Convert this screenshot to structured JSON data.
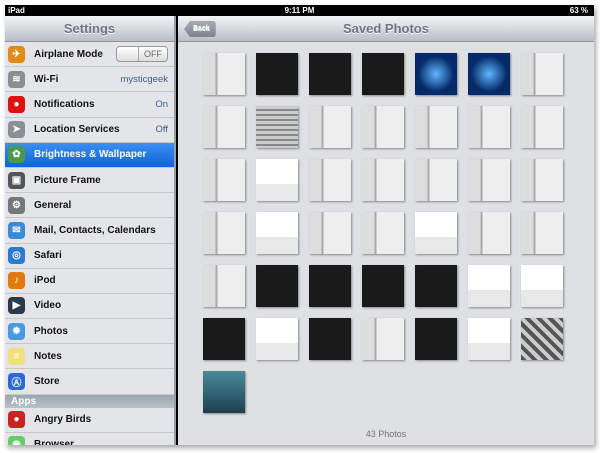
{
  "status": {
    "device": "iPad",
    "time": "9:11 PM",
    "battery": "63 %"
  },
  "sidebar": {
    "title": "Settings",
    "items": [
      {
        "label": "Airplane Mode",
        "toggle": "OFF",
        "icon": "airplane-icon",
        "color": "#e08a1a",
        "glyph": "✈"
      },
      {
        "label": "Wi-Fi",
        "value": "mysticgeek",
        "icon": "wifi-icon",
        "color": "#8a8f96",
        "glyph": "≋"
      },
      {
        "label": "Notifications",
        "value": "On",
        "icon": "notifications-icon",
        "color": "#d11",
        "glyph": "●"
      },
      {
        "label": "Location Services",
        "value": "Off",
        "icon": "location-icon",
        "color": "#8a8f96",
        "glyph": "➤"
      },
      {
        "label": "Brightness & Wallpaper",
        "icon": "brightness-icon",
        "color": "#4a9a4a",
        "glyph": "✿",
        "selected": true
      },
      {
        "label": "Picture Frame",
        "icon": "picture-frame-icon",
        "color": "#555",
        "glyph": "▣"
      },
      {
        "label": "General",
        "icon": "gear-icon",
        "color": "#777",
        "glyph": "⚙"
      },
      {
        "label": "Mail, Contacts, Calendars",
        "icon": "mail-icon",
        "color": "#3a8ad8",
        "glyph": "✉"
      },
      {
        "label": "Safari",
        "icon": "safari-icon",
        "color": "#2a7ad0",
        "glyph": "◎"
      },
      {
        "label": "iPod",
        "icon": "ipod-icon",
        "color": "#e07a10",
        "glyph": "♪"
      },
      {
        "label": "Video",
        "icon": "video-icon",
        "color": "#2a3a4a",
        "glyph": "▶"
      },
      {
        "label": "Photos",
        "icon": "photos-icon",
        "color": "#4a9ae0",
        "glyph": "✹"
      },
      {
        "label": "Notes",
        "icon": "notes-icon",
        "color": "#f0e07a",
        "glyph": "≡"
      },
      {
        "label": "Store",
        "icon": "store-icon",
        "color": "#2a6ad8",
        "glyph": "Ⓐ"
      }
    ],
    "apps_header": "Apps",
    "apps": [
      {
        "label": "Angry Birds",
        "icon": "angry-birds-icon",
        "color": "#c22",
        "glyph": "●"
      },
      {
        "label": "Browser",
        "icon": "browser-icon",
        "color": "#6c6",
        "glyph": "◉"
      }
    ]
  },
  "main": {
    "title": "Saved Photos",
    "back": "Back",
    "count": "43 Photos",
    "photo_count": 43
  }
}
